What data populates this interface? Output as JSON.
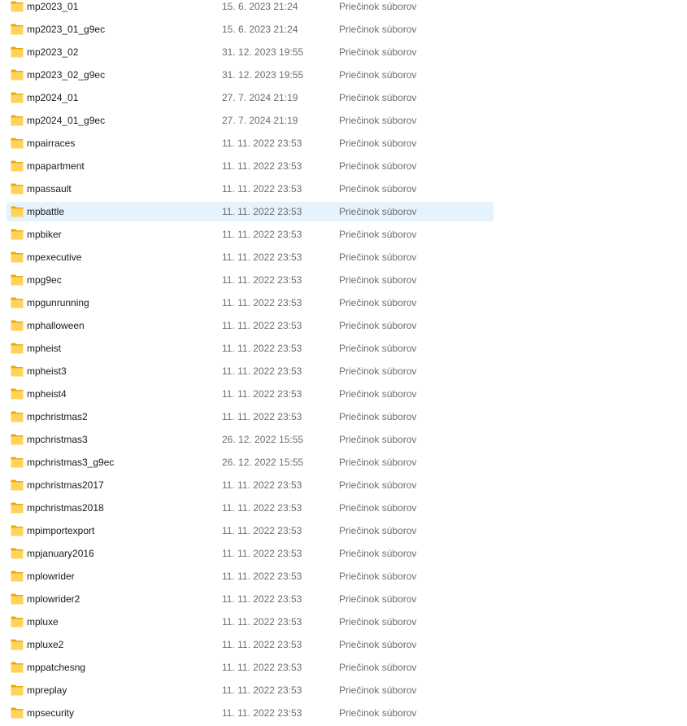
{
  "icon": "folder-icon",
  "colors": {
    "folder_back": "#e8a800",
    "folder_front": "#ffd35a",
    "selection": "#e5f3ff",
    "secondary_text": "#6d6d6d"
  },
  "selected_index": 9,
  "rows": [
    {
      "name": "mp2023_01",
      "date": "15. 6. 2023 21:24",
      "type": "Priečinok súborov"
    },
    {
      "name": "mp2023_01_g9ec",
      "date": "15. 6. 2023 21:24",
      "type": "Priečinok súborov"
    },
    {
      "name": "mp2023_02",
      "date": "31. 12. 2023 19:55",
      "type": "Priečinok súborov"
    },
    {
      "name": "mp2023_02_g9ec",
      "date": "31. 12. 2023 19:55",
      "type": "Priečinok súborov"
    },
    {
      "name": "mp2024_01",
      "date": "27. 7. 2024 21:19",
      "type": "Priečinok súborov"
    },
    {
      "name": "mp2024_01_g9ec",
      "date": "27. 7. 2024 21:19",
      "type": "Priečinok súborov"
    },
    {
      "name": "mpairraces",
      "date": "11. 11. 2022 23:53",
      "type": "Priečinok súborov"
    },
    {
      "name": "mpapartment",
      "date": "11. 11. 2022 23:53",
      "type": "Priečinok súborov"
    },
    {
      "name": "mpassault",
      "date": "11. 11. 2022 23:53",
      "type": "Priečinok súborov"
    },
    {
      "name": "mpbattle",
      "date": "11. 11. 2022 23:53",
      "type": "Priečinok súborov"
    },
    {
      "name": "mpbiker",
      "date": "11. 11. 2022 23:53",
      "type": "Priečinok súborov"
    },
    {
      "name": "mpexecutive",
      "date": "11. 11. 2022 23:53",
      "type": "Priečinok súborov"
    },
    {
      "name": "mpg9ec",
      "date": "11. 11. 2022 23:53",
      "type": "Priečinok súborov"
    },
    {
      "name": "mpgunrunning",
      "date": "11. 11. 2022 23:53",
      "type": "Priečinok súborov"
    },
    {
      "name": "mphalloween",
      "date": "11. 11. 2022 23:53",
      "type": "Priečinok súborov"
    },
    {
      "name": "mpheist",
      "date": "11. 11. 2022 23:53",
      "type": "Priečinok súborov"
    },
    {
      "name": "mpheist3",
      "date": "11. 11. 2022 23:53",
      "type": "Priečinok súborov"
    },
    {
      "name": "mpheist4",
      "date": "11. 11. 2022 23:53",
      "type": "Priečinok súborov"
    },
    {
      "name": "mpchristmas2",
      "date": "11. 11. 2022 23:53",
      "type": "Priečinok súborov"
    },
    {
      "name": "mpchristmas3",
      "date": "26. 12. 2022 15:55",
      "type": "Priečinok súborov"
    },
    {
      "name": "mpchristmas3_g9ec",
      "date": "26. 12. 2022 15:55",
      "type": "Priečinok súborov"
    },
    {
      "name": "mpchristmas2017",
      "date": "11. 11. 2022 23:53",
      "type": "Priečinok súborov"
    },
    {
      "name": "mpchristmas2018",
      "date": "11. 11. 2022 23:53",
      "type": "Priečinok súborov"
    },
    {
      "name": "mpimportexport",
      "date": "11. 11. 2022 23:53",
      "type": "Priečinok súborov"
    },
    {
      "name": "mpjanuary2016",
      "date": "11. 11. 2022 23:53",
      "type": "Priečinok súborov"
    },
    {
      "name": "mplowrider",
      "date": "11. 11. 2022 23:53",
      "type": "Priečinok súborov"
    },
    {
      "name": "mplowrider2",
      "date": "11. 11. 2022 23:53",
      "type": "Priečinok súborov"
    },
    {
      "name": "mpluxe",
      "date": "11. 11. 2022 23:53",
      "type": "Priečinok súborov"
    },
    {
      "name": "mpluxe2",
      "date": "11. 11. 2022 23:53",
      "type": "Priečinok súborov"
    },
    {
      "name": "mppatchesng",
      "date": "11. 11. 2022 23:53",
      "type": "Priečinok súborov"
    },
    {
      "name": "mpreplay",
      "date": "11. 11. 2022 23:53",
      "type": "Priečinok súborov"
    },
    {
      "name": "mpsecurity",
      "date": "11. 11. 2022 23:53",
      "type": "Priečinok súborov"
    }
  ]
}
